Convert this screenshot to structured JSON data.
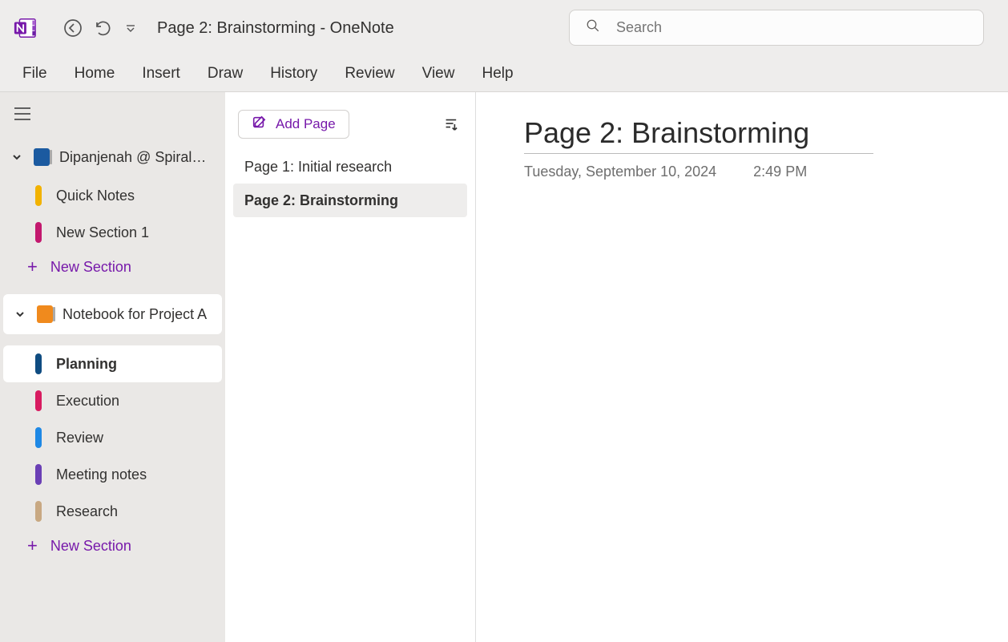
{
  "app": {
    "title": "Page 2: Brainstorming",
    "title_sep": "  -  ",
    "name": "OneNote"
  },
  "search": {
    "placeholder": "Search"
  },
  "menu": {
    "file": "File",
    "home": "Home",
    "insert": "Insert",
    "draw": "Draw",
    "history": "History",
    "review": "Review",
    "view": "View",
    "help": "Help"
  },
  "notebooks": {
    "nb1": {
      "label": "Dipanjenah @ Spiral…"
    },
    "nb1_sections": {
      "s0": {
        "label": "Quick Notes",
        "color": "#f2b200"
      },
      "s1": {
        "label": "New Section 1",
        "color": "#c3186e"
      }
    },
    "nb2": {
      "label": "Notebook for Project A"
    },
    "nb2_sections": {
      "s0": {
        "label": "Planning",
        "color": "#0f4c81"
      },
      "s1": {
        "label": "Execution",
        "color": "#d81b60"
      },
      "s2": {
        "label": "Review",
        "color": "#1e88e5"
      },
      "s3": {
        "label": "Meeting notes",
        "color": "#6a3fb5"
      },
      "s4": {
        "label": "Research",
        "color": "#c8a882"
      }
    },
    "add_section": "New Section"
  },
  "pages": {
    "add_label": "Add Page",
    "items": {
      "p0": {
        "label": "Page 1: Initial research"
      },
      "p1": {
        "label": "Page 2: Brainstorming"
      }
    }
  },
  "page": {
    "title": "Page 2: Brainstorming",
    "date": "Tuesday, September 10, 2024",
    "time": "2:49 PM"
  }
}
